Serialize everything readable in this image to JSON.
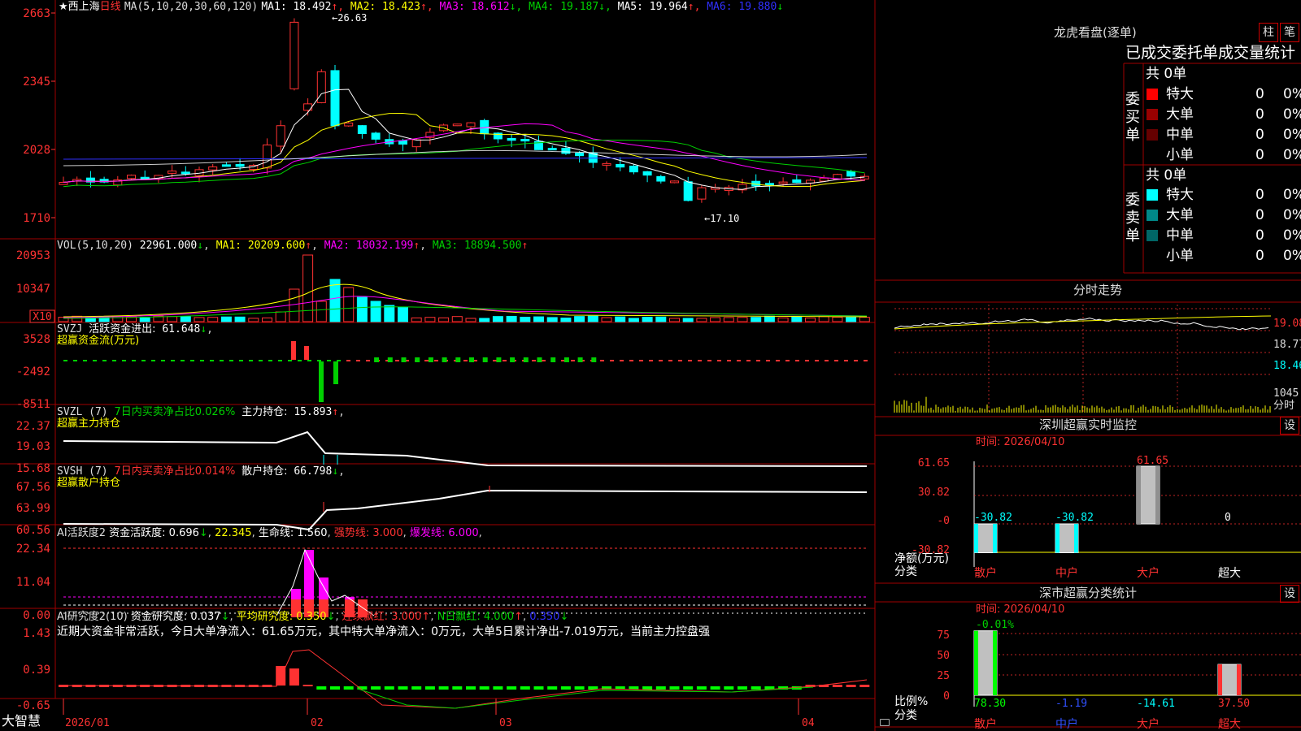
{
  "app": {
    "brand": "大智慧",
    "lock_icon": "lock-icon"
  },
  "colors": {
    "up": "#ff3232",
    "down": "#00ffff",
    "frame": "#b00000",
    "white": "#ffffff",
    "yellow": "#ffff00",
    "magenta": "#ff00ff",
    "green": "#00d000",
    "blue": "#3030ff"
  },
  "kline": {
    "star": "★",
    "stock_name": "西上海",
    "period": "日线",
    "ma_params": "MA(5,10,20,30,60,120)",
    "ma_values": [
      {
        "label": "MA1:",
        "value": "18.492",
        "arrow": "↑",
        "color": "#ffffff"
      },
      {
        "label": "MA2:",
        "value": "18.423",
        "arrow": "↑",
        "color": "#ffff00"
      },
      {
        "label": "MA3:",
        "value": "18.612",
        "arrow": "↓",
        "color": "#ff00ff"
      },
      {
        "label": "MA4:",
        "value": "19.187",
        "arrow": "↓",
        "color": "#00d000"
      },
      {
        "label": "MA5:",
        "value": "19.964",
        "arrow": "↑",
        "color": "#ffffff"
      },
      {
        "label": "MA6:",
        "value": "19.880",
        "arrow": "↓",
        "color": "#3030ff"
      }
    ],
    "y_ticks": [
      "2663",
      "2345",
      "2028",
      "1710"
    ],
    "high_mark": "26.63",
    "low_mark": "17.10"
  },
  "vol": {
    "title": "VOL(5,10,20)",
    "value": "22961.000",
    "value_arrow": "↓",
    "ma1": "20209.600",
    "ma2": "18032.199",
    "ma3": "18894.500",
    "y_ticks": [
      "20953",
      "10347"
    ],
    "unit": "X10"
  },
  "svzj": {
    "title": "SVZJ",
    "label": "活跃资金进出:",
    "value": "61.648",
    "arrow": "↓",
    "subtitle": "超赢资金流(万元)",
    "y_ticks": [
      "3528",
      "-2492",
      "-8511"
    ]
  },
  "svzl": {
    "title": "SVZL (7)",
    "label1": "7日内买卖净占比0.026%",
    "label2": "主力持仓:",
    "value": "15.893",
    "arrow": "↑",
    "subtitle": "超赢主力持仓",
    "y_ticks": [
      "22.37",
      "19.03",
      "15.68"
    ]
  },
  "svsh": {
    "title": "SVSH (7)",
    "label1": "7日内买卖净占比0.014%",
    "label2": "散户持仓:",
    "value": "66.798",
    "arrow": "↓",
    "subtitle": "超赢散户持仓",
    "y_ticks": [
      "67.56",
      "63.99",
      "60.56"
    ]
  },
  "ai1": {
    "title": "AI活跃度2",
    "label": "资金活跃度:",
    "value": "0.696",
    "arrow": "↓",
    "v2": "22.345",
    "life_label": "生命线:",
    "life": "1.560",
    "strong_label": "强势线:",
    "strong": "3.000",
    "burst_label": "爆发线:",
    "burst": "6.000",
    "y_ticks": [
      "22.34",
      "11.04",
      "0.00"
    ]
  },
  "ai2": {
    "title": "AI研究度2(10)",
    "label": "资金研究度:",
    "value": "0.037",
    "arrow": "↓",
    "avg_label": "平均研究度:",
    "avg": "0.350",
    "lx_label": "连续飘红:",
    "lx": "3.000",
    "n_label": "N日飘红:",
    "n": "4.000",
    "last": "0.350",
    "comment": "近期大资金非常活跃，今日大单净流入：61.65万元，其中特大单净流入：0万元，大单5日累计净出-7.019万元，当前主力控盘强",
    "y_ticks": [
      "1.43",
      "0.39",
      "-0.65"
    ]
  },
  "xaxis": [
    "2026/01",
    "02",
    "03",
    "04"
  ],
  "lhb": {
    "title": "龙虎看盘(逐单)",
    "tab1": "柱",
    "tab2": "笔",
    "header": "已成交委托单成交量统计",
    "buy_title": "委买单",
    "sell_title": "委卖单",
    "buy_total": "共 0单",
    "sell_total": "共 0单",
    "rows": [
      {
        "name": "特大",
        "qty": "0",
        "pct": "0%"
      },
      {
        "name": "大单",
        "qty": "0",
        "pct": "0%"
      },
      {
        "name": "中单",
        "qty": "0",
        "pct": "0%"
      },
      {
        "name": "小单",
        "qty": "0",
        "pct": "0%"
      }
    ]
  },
  "fenshi": {
    "title": "分时走势",
    "prices": [
      "19.08",
      "18.77",
      "18.46"
    ],
    "vol_label": "1045",
    "vol_unit": "分时"
  },
  "sz_monitor": {
    "title": "深圳超赢实时监控",
    "gear": "设",
    "date_label": "时间: 2026/04/10",
    "y_ticks": [
      "61.65",
      "30.82",
      "-0",
      "-30.82"
    ],
    "ylabel": "净额(万元)",
    "xlabel": "分类",
    "categories": [
      "散户",
      "中户",
      "大户",
      "超大"
    ],
    "values": [
      -30.82,
      -30.82,
      61.65,
      0
    ],
    "labels": [
      "-30.82",
      "-30.82",
      "61.65",
      "0"
    ]
  },
  "sz_class": {
    "title": "深市超赢分类统计",
    "gear": "设",
    "date_label": "时间: 2026/04/10",
    "top_value": "-0.01%",
    "y_ticks": [
      "75",
      "50",
      "25",
      "0"
    ],
    "ylabel": "比例%",
    "xlabel": "分类",
    "categories": [
      "散户",
      "中户",
      "大户",
      "超大"
    ],
    "values": [
      78.3,
      -1.19,
      -14.61,
      37.5
    ],
    "labels": [
      "78.30",
      "-1.19",
      "-14.61",
      "37.50"
    ]
  }
}
